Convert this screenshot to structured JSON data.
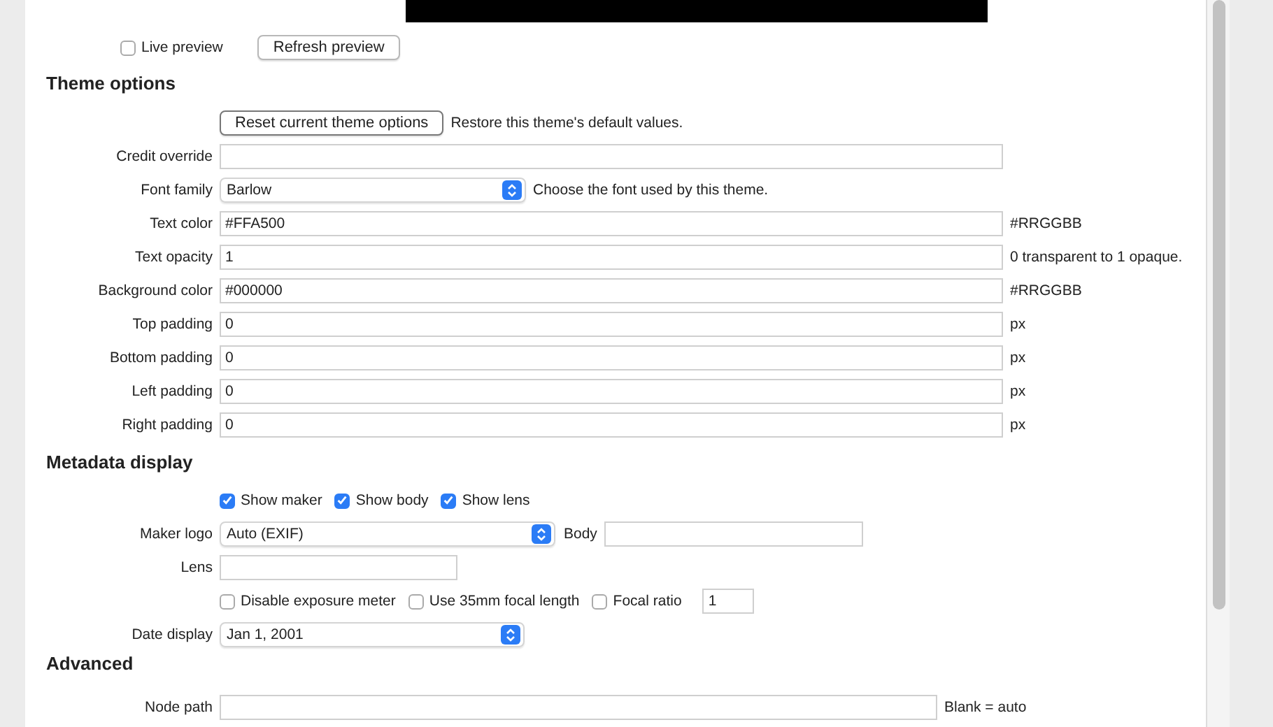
{
  "preview": {
    "live_preview": {
      "label": "Live preview",
      "checked": false
    },
    "refresh_button": "Refresh preview"
  },
  "theme_options": {
    "title": "Theme options",
    "rows": [
      {
        "kind": "button",
        "label": "Reset current theme options",
        "hint": "Restore this theme's default values."
      },
      {
        "kind": "text",
        "label": "Credit override"
      },
      {
        "kind": "select",
        "label": "Font family",
        "value": "Barlow",
        "hint": "Choose the font used by this theme."
      },
      {
        "kind": "text",
        "label": "Text color",
        "value": "#FFA500",
        "hint": "#RRGGBB"
      },
      {
        "kind": "text",
        "label": "Text opacity",
        "value": "1",
        "hint": "0 transparent to 1 opaque."
      },
      {
        "kind": "text",
        "label": "Background color",
        "value": "#000000",
        "hint": "#RRGGBB"
      },
      {
        "kind": "text",
        "label": "Top padding",
        "value": "0",
        "hint": "px"
      },
      {
        "kind": "text",
        "label": "Bottom padding",
        "value": "0",
        "hint": "px"
      },
      {
        "kind": "text",
        "label": "Left padding",
        "value": "0",
        "hint": "px"
      },
      {
        "kind": "text",
        "label": "Right padding",
        "value": "0",
        "hint": "px"
      }
    ]
  },
  "metadata_display": {
    "title": "Metadata display",
    "show_checks": [
      {
        "label": "Show maker",
        "checked": true
      },
      {
        "label": "Show body",
        "checked": true
      },
      {
        "label": "Show lens",
        "checked": true
      }
    ],
    "maker_logo": {
      "label": "Maker logo",
      "value": "Auto (EXIF)"
    },
    "body": {
      "label": "Body"
    },
    "lens": {
      "label": "Lens"
    },
    "options": [
      {
        "label": "Disable exposure meter",
        "checked": false
      },
      {
        "label": "Use 35mm focal length",
        "checked": false
      },
      {
        "label": "Focal ratio",
        "checked": false
      }
    ],
    "focal_ratio_value": "1",
    "date_display": {
      "label": "Date display",
      "value": "Jan 1, 2001"
    }
  },
  "advanced": {
    "title": "Advanced",
    "node_path": {
      "label": "Node path",
      "hint": "Blank = auto"
    }
  }
}
